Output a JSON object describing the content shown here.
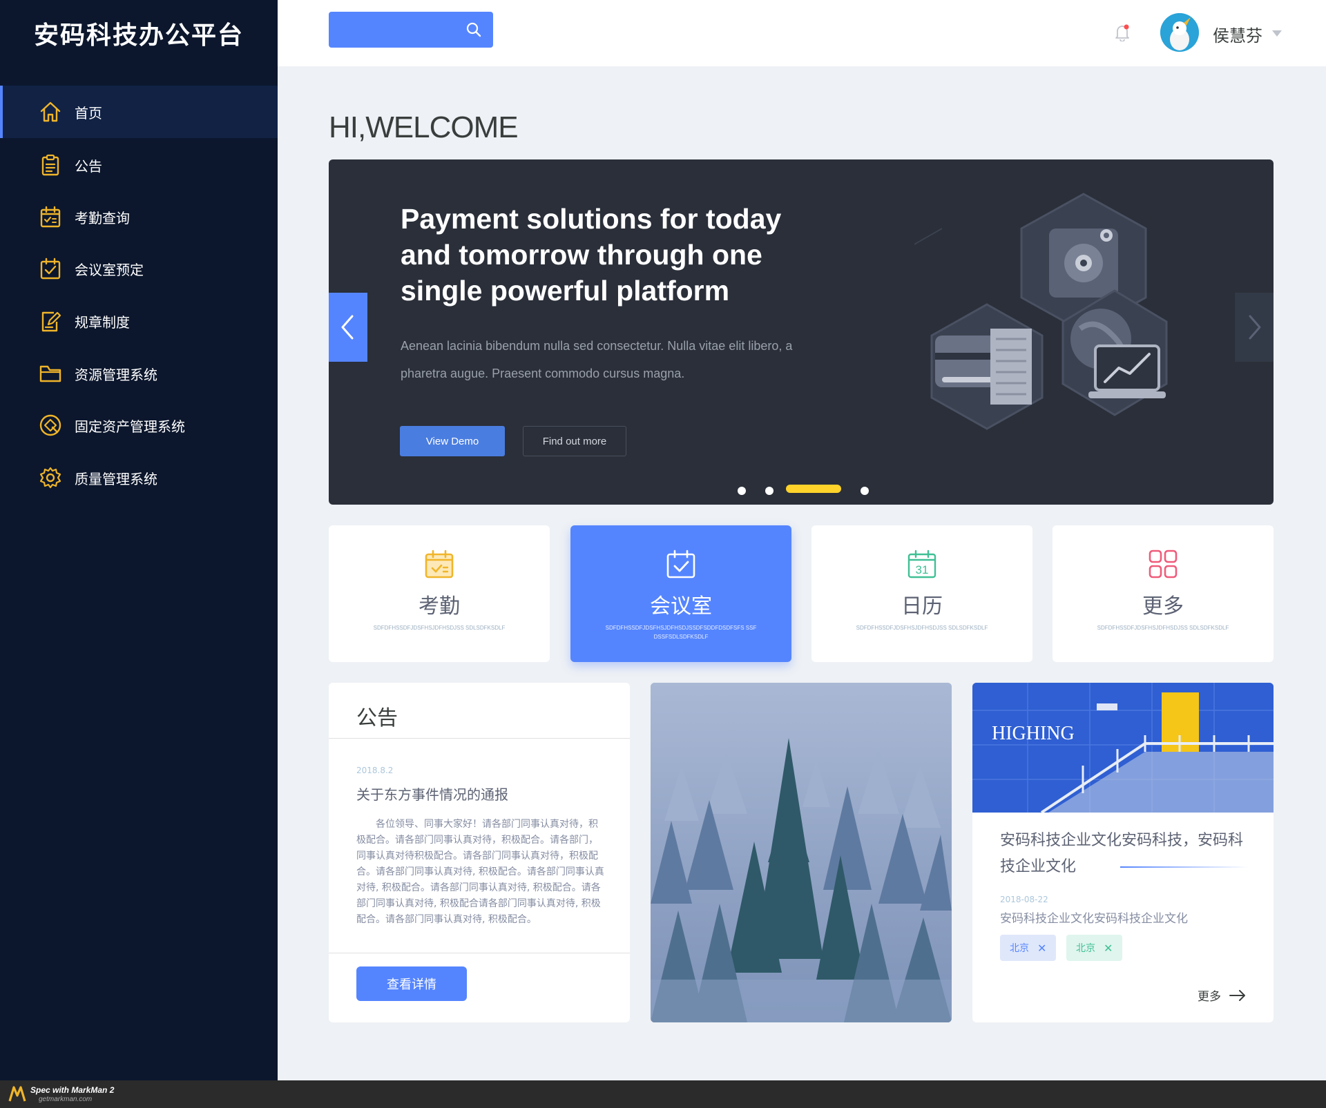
{
  "app": {
    "title": "安码科技办公平台"
  },
  "sidebar": {
    "items": [
      {
        "label": "首页",
        "icon": "home-icon",
        "active": true
      },
      {
        "label": "公告",
        "icon": "clipboard-icon"
      },
      {
        "label": "考勤查询",
        "icon": "attendance-calendar-icon"
      },
      {
        "label": "会议室预定",
        "icon": "calendar-check-icon"
      },
      {
        "label": "规章制度",
        "icon": "edit-document-icon"
      },
      {
        "label": "资源管理系统",
        "icon": "folder-icon"
      },
      {
        "label": "固定资产管理系统",
        "icon": "asset-icon"
      },
      {
        "label": "质量管理系统",
        "icon": "gear-icon"
      }
    ]
  },
  "header": {
    "search": {
      "placeholder": "",
      "icon": "search-icon"
    },
    "notification_icon": "bell-icon",
    "user": {
      "name": "侯慧芬"
    }
  },
  "welcome": "HI,WELCOME",
  "banner": {
    "headline": "Payment solutions for today and tomorrow through one single powerful platform",
    "description": "Aenean lacinia bibendum nulla sed consectetur. Nulla vitae elit libero, a pharetra augue. Praesent commodo cursus magna.",
    "primary_button": "View Demo",
    "secondary_button": "Find out more",
    "slide_count": 4,
    "active_slide": 3
  },
  "quick_cards": [
    {
      "title": "考勤",
      "subtitle": "SDFDFHSSDFJDSFHSJDFHSDJSS SDLSDFKSDLF",
      "icon": "attendance-calendar-icon"
    },
    {
      "title": "会议室",
      "subtitle": "SDFDFHSSDFJDSFHSJDFHSDJSSDFSDDFDSDFSFS SSFDSSFSDLSDFKSDLF",
      "icon": "calendar-check-icon",
      "active": true
    },
    {
      "title": "日历",
      "subtitle": "SDFDFHSSDFJDSFHSJDFHSDJSS SDLSDFKSDLF",
      "icon": "calendar-31-icon",
      "day": "31"
    },
    {
      "title": "更多",
      "subtitle": "SDFDFHSSDFJDSFHSJDFHSDJSS SDLSDFKSDLF",
      "icon": "grid-icon"
    }
  ],
  "notice": {
    "title": "公告",
    "date": "2018.8.2",
    "heading": "关于东方事件情况的通报",
    "body": "各位领导、同事大家好！请各部门同事认真对待，积极配合。请各部门同事认真对待，积极配合。请各部门，同事认真对待积极配合。请各部门同事认真对待，积极配合。请各部门同事认真对待, 积极配合。请各部门同事认真对待, 积极配合。请各部门同事认真对待, 积极配合。请各部门同事认真对待, 积极配合请各部门同事认真对待, 积极配合。请各部门同事认真对待, 积极配合。",
    "button": "查看详情"
  },
  "culture": {
    "image_text": "HIGHING",
    "title": "安码科技企业文化安码科技，安码科技企业文化",
    "date": "2018-08-22",
    "description": "安码科技企业文化安码科技企业文化",
    "tags": [
      "北京",
      "北京"
    ],
    "more": "更多"
  },
  "footer": {
    "brand": "Spec with MarkMan 2",
    "url": "getmarkman.com"
  },
  "colors": {
    "sidebar_bg": "#0c172d",
    "sidebar_active": "#112245",
    "accent": "#5585fe",
    "icon_yellow": "#f0b52a",
    "text_dark": "#393e3d",
    "text_mid": "#5c6273",
    "text_light": "#858da2",
    "subtitle": "#9bafc0",
    "divider": "#e0e0e0",
    "banner_dot_active": "#ffd32a"
  }
}
